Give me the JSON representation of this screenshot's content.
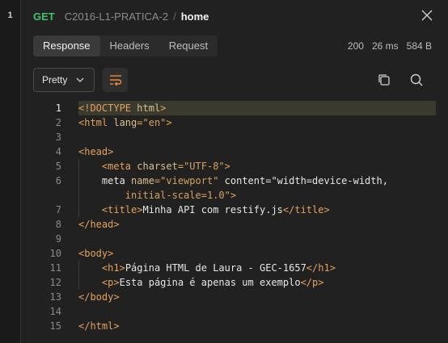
{
  "gutter": {
    "line": "1"
  },
  "header": {
    "method": "GET",
    "collection": "C2016-L1-PRATICA-2",
    "separator": "/",
    "request_name": "home"
  },
  "tabs": [
    {
      "label": "Response",
      "active": true
    },
    {
      "label": "Headers",
      "active": false
    },
    {
      "label": "Request",
      "active": false
    }
  ],
  "stats": {
    "status": "200",
    "time": "26 ms",
    "size": "584 B"
  },
  "toolbar": {
    "format": "Pretty"
  },
  "code_lines": [
    {
      "n": "1",
      "text": "<!DOCTYPE html>"
    },
    {
      "n": "2",
      "text": "<html lang=\"en\">"
    },
    {
      "n": "3",
      "text": ""
    },
    {
      "n": "4",
      "text": "<head>"
    },
    {
      "n": "5",
      "text": "    <meta charset=\"UTF-8\">"
    },
    {
      "n": "6",
      "text": "    <meta name=\"viewport\" content=\"width=device-width,"
    },
    {
      "n": "",
      "text": "        initial-scale=1.0\">"
    },
    {
      "n": "7",
      "text": "    <title>Minha API com restify.js</title>"
    },
    {
      "n": "8",
      "text": "</head>"
    },
    {
      "n": "9",
      "text": ""
    },
    {
      "n": "10",
      "text": "<body>"
    },
    {
      "n": "11",
      "text": "    <h1>Página HTML de Laura - GEC-1657</h1>"
    },
    {
      "n": "12",
      "text": "    <p>Esta página é apenas um exemplo</p>"
    },
    {
      "n": "13",
      "text": "</body>"
    },
    {
      "n": "14",
      "text": ""
    },
    {
      "n": "15",
      "text": "</html>"
    }
  ]
}
